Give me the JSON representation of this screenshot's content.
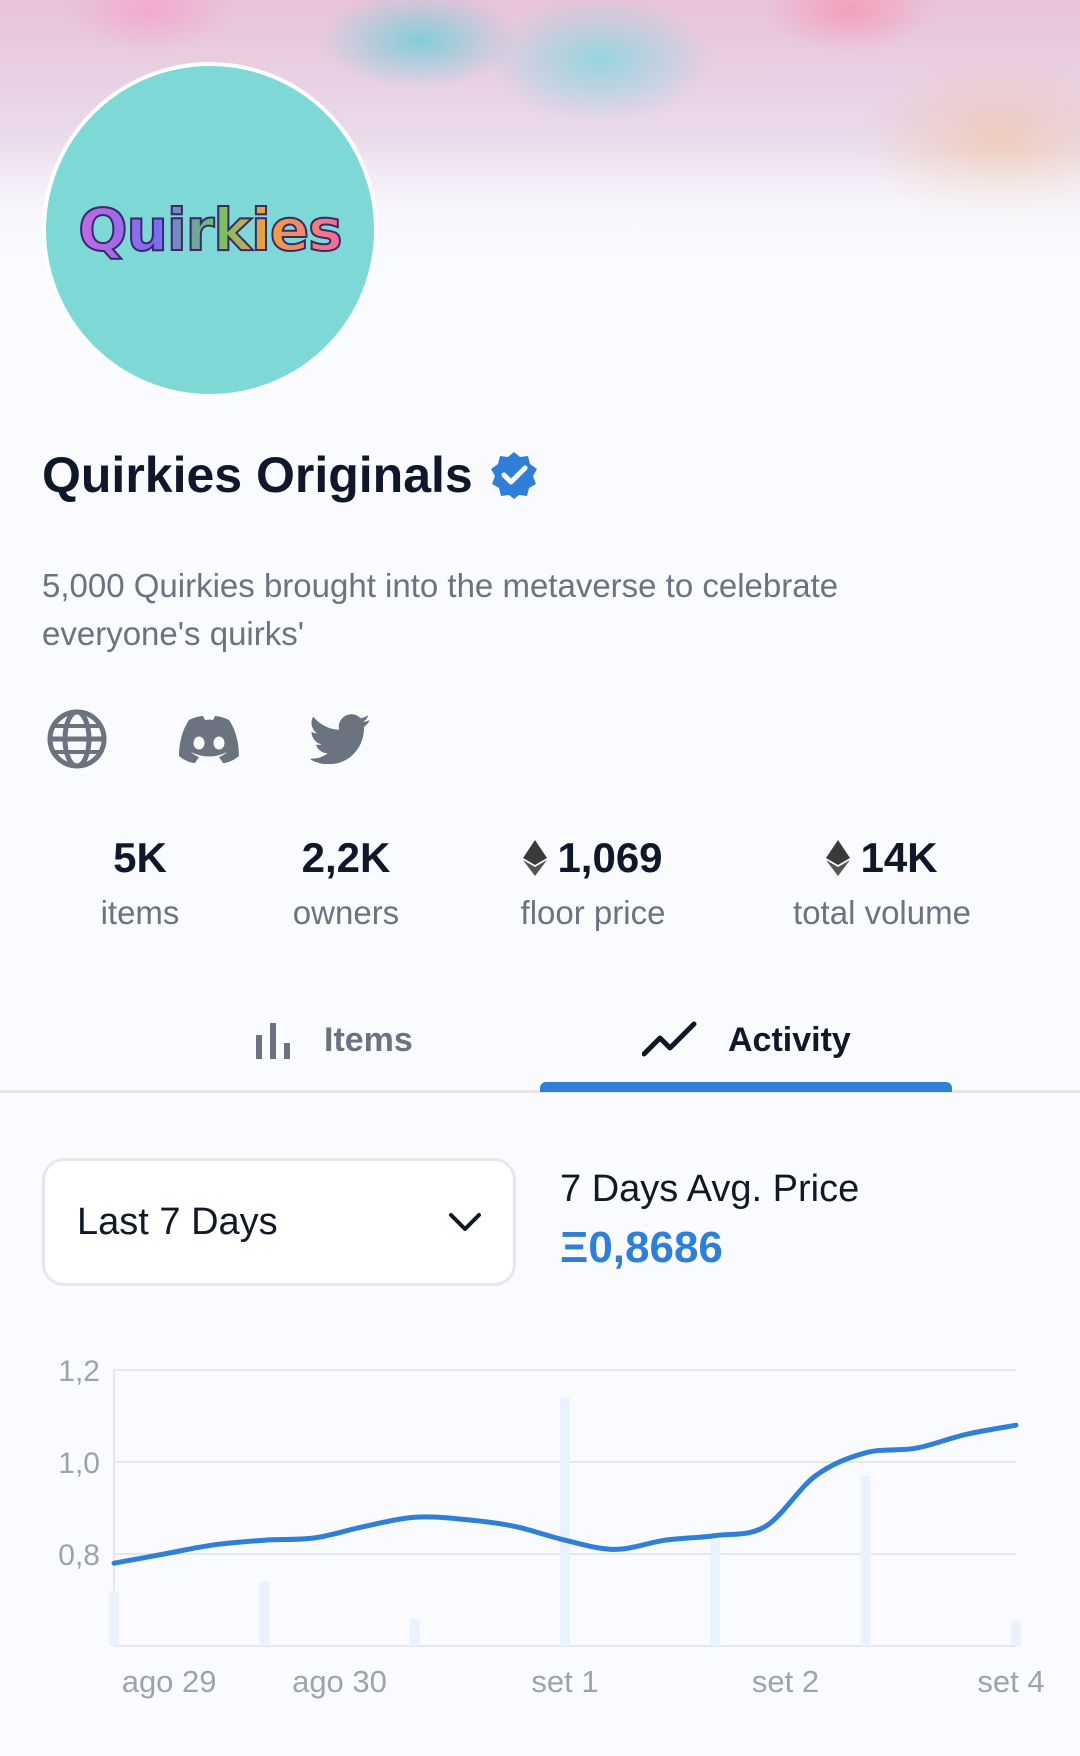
{
  "collection": {
    "name": "Quirkies Originals",
    "avatar_text": "Quirkies",
    "verified": true,
    "description": "5,000 Quirkies brought into the metaverse to celebrate everyone's quirks'"
  },
  "socials": [
    {
      "icon": "globe-icon"
    },
    {
      "icon": "discord-icon"
    },
    {
      "icon": "twitter-icon"
    }
  ],
  "stats": [
    {
      "value": "5K",
      "label": "items",
      "eth": false
    },
    {
      "value": "2,2K",
      "label": "owners",
      "eth": false
    },
    {
      "value": "1,069",
      "label": "floor price",
      "eth": true
    },
    {
      "value": "14K",
      "label": "total volume",
      "eth": true
    }
  ],
  "tabs": [
    {
      "label": "Items",
      "icon": "bar-chart-icon",
      "active": false
    },
    {
      "label": "Activity",
      "icon": "trend-line-icon",
      "active": true
    }
  ],
  "filter": {
    "selected": "Last 7 Days",
    "icon": "chevron-down-icon"
  },
  "average": {
    "label": "7 Days Avg. Price",
    "value": "Ξ0,8686"
  },
  "colors": {
    "accent": "#2f7fd8",
    "volume_bar": "#eaf3fd"
  },
  "chart_data": {
    "type": "line",
    "x_tick_labels": [
      "ago 29",
      "ago 30",
      "set 1",
      "set 2",
      "set 4"
    ],
    "y_tick_labels": [
      "1,2",
      "1,0",
      "0,8"
    ],
    "ylim": [
      0.6,
      1.2
    ],
    "grid": true,
    "series": [
      {
        "x": [
          0,
          0.5,
          1,
          1.5,
          2,
          2.5,
          3,
          3.5,
          4,
          4.5,
          5,
          5.5,
          6,
          6.5,
          7,
          7.5,
          8,
          8.5,
          9
        ],
        "y": [
          0.78,
          0.8,
          0.82,
          0.83,
          0.835,
          0.86,
          0.88,
          0.875,
          0.86,
          0.83,
          0.81,
          0.83,
          0.84,
          0.86,
          0.97,
          1.02,
          1.03,
          1.06,
          1.08
        ]
      }
    ],
    "volume_bars": {
      "x": [
        0,
        1.5,
        3,
        4.5,
        6,
        7.5,
        9
      ],
      "values": [
        0.72,
        0.74,
        0.66,
        1.14,
        0.83,
        0.97,
        0.655
      ]
    }
  }
}
